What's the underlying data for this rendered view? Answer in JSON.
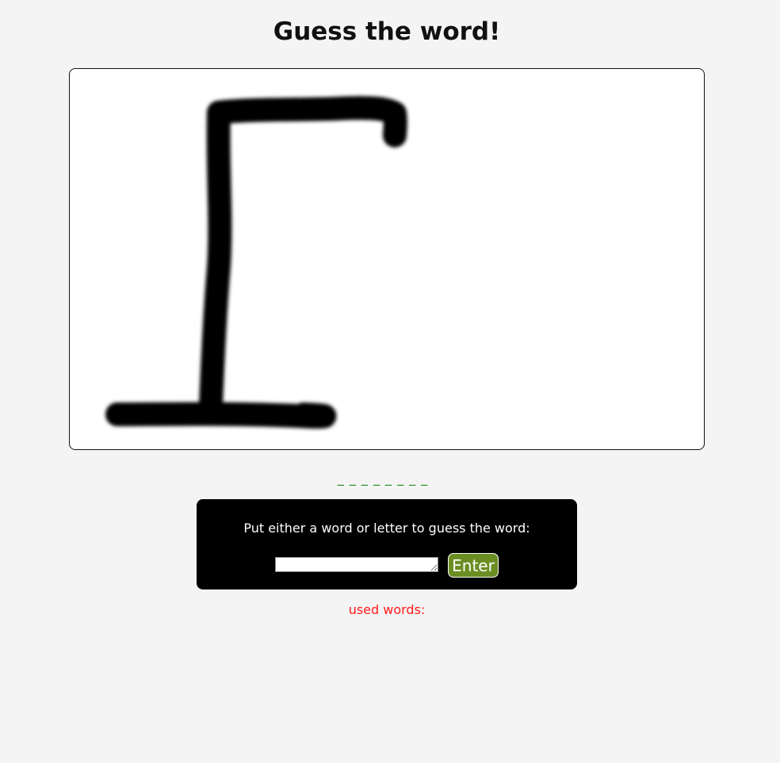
{
  "page": {
    "title": "Guess the word!"
  },
  "word": {
    "display": "_ _ _ _ _ _ _ _",
    "letter_count": 8,
    "color": "#1a8a1a"
  },
  "guess_panel": {
    "label": "Put either a word or letter to guess the word:",
    "input_value": "",
    "input_placeholder": "",
    "enter_label": "Enter",
    "button_color": "#6b8e23"
  },
  "used_words": {
    "label": "used words:",
    "items": [],
    "color": "#ff1a1a"
  },
  "hangman": {
    "stage": "gallows",
    "parts_drawn": [
      "base",
      "pole",
      "beam",
      "rope"
    ]
  }
}
